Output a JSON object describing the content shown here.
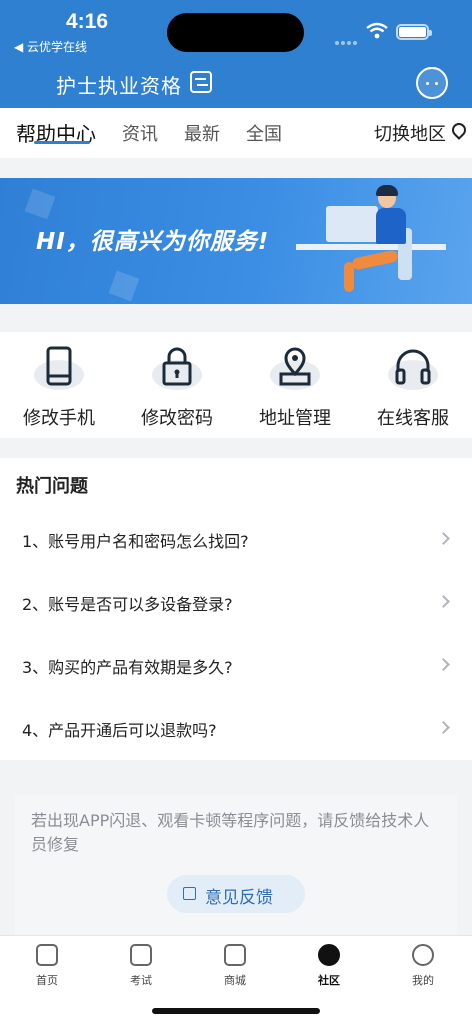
{
  "status": {
    "time": "4:16",
    "back_app": "◀ 云优学在线"
  },
  "header": {
    "title": "护士执业资格"
  },
  "tabs": [
    {
      "label": "帮助中心"
    },
    {
      "label": "资讯"
    },
    {
      "label": "最新"
    },
    {
      "label": "全国"
    }
  ],
  "region": {
    "label": "切换地区"
  },
  "banner": {
    "text": "HI，很高兴为你服务!"
  },
  "actions": [
    {
      "label": "修改手机",
      "icon": "phone-icon"
    },
    {
      "label": "修改密码",
      "icon": "lock-icon"
    },
    {
      "label": "地址管理",
      "icon": "location-icon"
    },
    {
      "label": "在线客服",
      "icon": "headset-icon"
    }
  ],
  "hot": {
    "title": "热门问题",
    "questions": [
      "1、账号用户名和密码怎么找回?",
      "2、账号是否可以多设备登录?",
      "3、购买的产品有效期是多久?",
      "4、产品开通后可以退款吗?"
    ]
  },
  "feedback": {
    "text": "若出现APP闪退、观看卡顿等程序问题，请反馈给技术人员修复",
    "button": "意见反馈"
  },
  "nav": [
    {
      "label": "首页"
    },
    {
      "label": "考试"
    },
    {
      "label": "商城"
    },
    {
      "label": "社区"
    },
    {
      "label": "我的"
    }
  ],
  "colors": {
    "brand": "#2f80d1"
  }
}
